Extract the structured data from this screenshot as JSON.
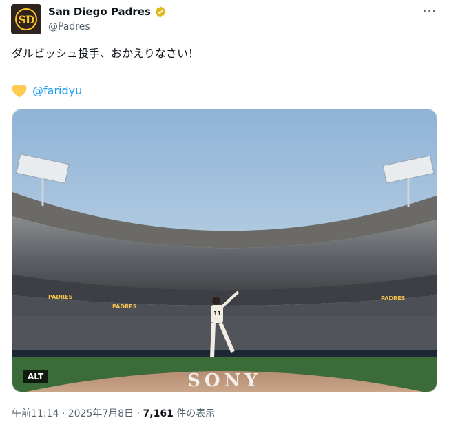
{
  "account": {
    "display_name": "San Diego Padres",
    "handle": "@Padres",
    "avatar_logo": "SD"
  },
  "tweet": {
    "text_line1": "ダルビッシュ投手、おかえりなさい！",
    "mention": "@faridyu",
    "emoji": "yellow-heart",
    "image": {
      "alt_badge": "ALT",
      "field_sign": "SONY",
      "banners": [
        "PADRES",
        "PADRES",
        "PADRES"
      ],
      "jersey_number": "11"
    }
  },
  "meta": {
    "time": "午前11:14",
    "separator": "·",
    "date": "2025年7月8日",
    "views_count": "7,161",
    "views_label": "件の表示"
  },
  "colors": {
    "link": "#1d9bf0",
    "verified": "#e2b719",
    "secondary_text": "#536471"
  }
}
